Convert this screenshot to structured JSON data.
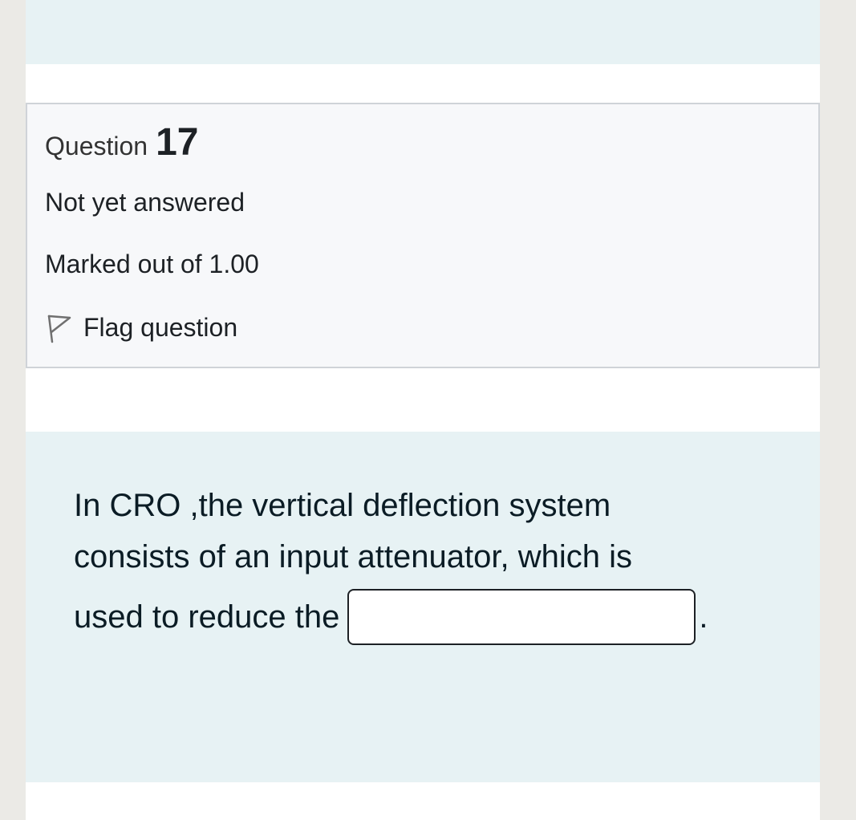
{
  "question_info": {
    "question_word": "Question",
    "question_number": "17",
    "state": "Not yet answered",
    "grade": "Marked out of 1.00",
    "flag_label": "Flag question",
    "flag_icon": "flag-outline-icon"
  },
  "question": {
    "line1": "In CRO ,the vertical deflection system",
    "line2": "consists of an input attenuator, which is",
    "line3": "used to reduce the",
    "answer_value": "",
    "trailing": "."
  },
  "colors": {
    "band": "#e7f2f4",
    "info_box_bg": "#f7f8fa",
    "info_box_border": "#cfd3d8",
    "text": "#1d2125"
  }
}
